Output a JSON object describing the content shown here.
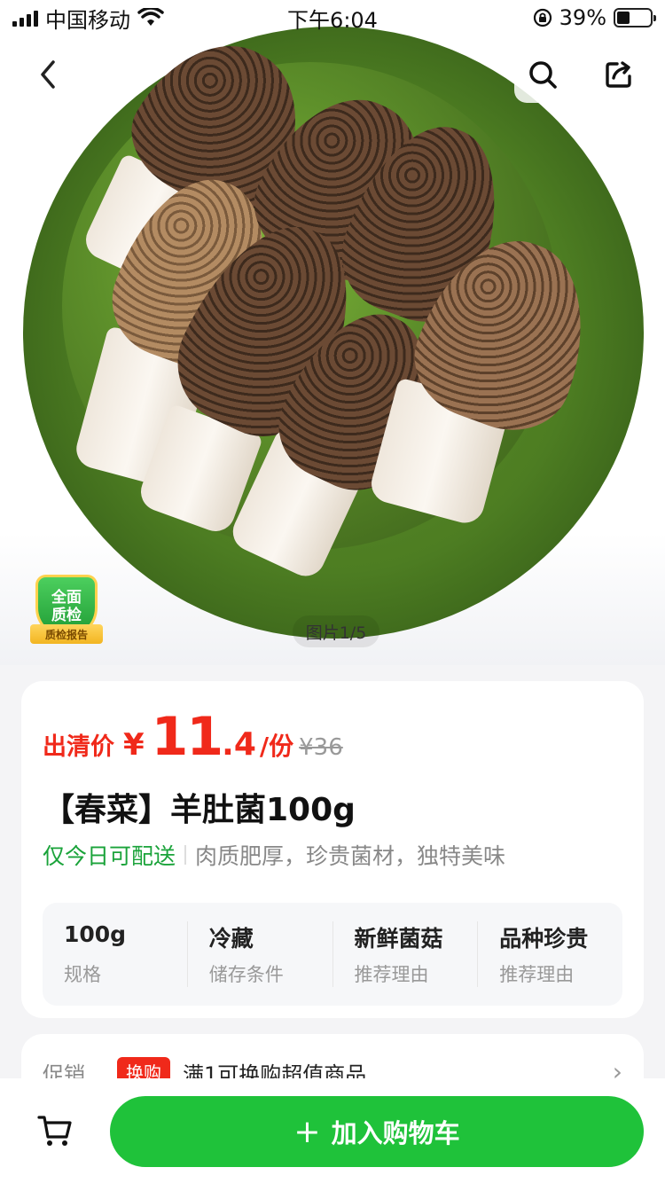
{
  "status_bar": {
    "carrier": "中国移动",
    "time": "下午6:04",
    "battery": "39%",
    "battery_level": 0.39
  },
  "hero": {
    "image_counter": "图片1/5",
    "qc_badge_line1": "全面",
    "qc_badge_line2": "质检",
    "qc_badge_ribbon": "质检报告"
  },
  "nav": {
    "back_icon": "chevron-left-icon",
    "search_icon": "search-icon",
    "share_icon": "share-icon"
  },
  "product": {
    "price_label": "出清价",
    "currency": "¥",
    "price_int": "11",
    "price_dec": ".4",
    "unit": "/份",
    "original_price": "¥36",
    "title": "【春菜】羊肚菌100g",
    "delivery": "仅今日可配送",
    "description": "肉质肥厚，珍贵菌材，独特美味"
  },
  "specs": [
    {
      "value": "100g",
      "label": "规格"
    },
    {
      "value": "冷藏",
      "label": "储存条件"
    },
    {
      "value": "新鲜菌菇",
      "label": "推荐理由"
    },
    {
      "value": "品种珍贵",
      "label": "推荐理由"
    }
  ],
  "promo": {
    "label": "促销",
    "tag": "换购",
    "text": "满1可换购超值商品",
    "chevron": "›"
  },
  "bottom": {
    "cart_icon": "cart-icon",
    "add_to_cart": "加入购物车",
    "plus": "+"
  },
  "colors": {
    "accent_green": "#1fc23a",
    "price_red": "#f0291a"
  }
}
